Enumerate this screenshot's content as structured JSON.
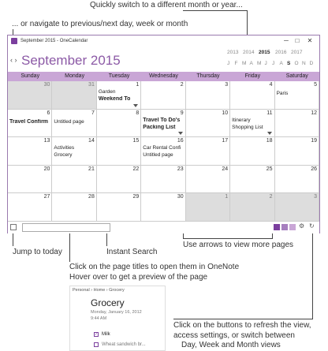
{
  "callouts": {
    "top": "Quickly switch to a different month or year...",
    "nav": "... or navigate to previous/next day, week or month",
    "today": "Jump to today",
    "search": "Instant Search",
    "arrows": "Use arrows to view more pages",
    "titles1": "Click on the page titles to open them in OneNote",
    "titles2": "Hover over to get a preview of the page",
    "buttons1": "Click on the buttons to refresh the view,",
    "buttons2": "access settings, or switch between",
    "buttons3": "Day, Week and Month views"
  },
  "window": {
    "title": "September 2015 - OneCalendar",
    "month_title": "September 2015",
    "minimize": "─",
    "maximize": "□",
    "close": "✕",
    "nav": "‹ ›"
  },
  "years": [
    "2013",
    "2014",
    "2015",
    "2016",
    "2017"
  ],
  "selected_year": "2015",
  "months": [
    "J",
    "F",
    "M",
    "A",
    "M",
    "J",
    "J",
    "A",
    "S",
    "O",
    "N",
    "D"
  ],
  "selected_month_index": 8,
  "day_headers": [
    "Sunday",
    "Monday",
    "Tuesday",
    "Wednesday",
    "Thursday",
    "Friday",
    "Saturday"
  ],
  "weeks": [
    [
      {
        "num": "30",
        "other": true,
        "pages": []
      },
      {
        "num": "31",
        "other": true,
        "pages": []
      },
      {
        "num": "1",
        "pages": [
          {
            "t": "Garden"
          },
          {
            "t": "Weekend To",
            "b": true
          }
        ],
        "more": true
      },
      {
        "num": "2",
        "pages": []
      },
      {
        "num": "3",
        "pages": []
      },
      {
        "num": "4",
        "pages": []
      },
      {
        "num": "5",
        "pages": [
          {
            "t": "Paris"
          }
        ]
      }
    ],
    [
      {
        "num": "6",
        "pages": [
          {
            "t": "Travel Confirm",
            "b": true
          }
        ]
      },
      {
        "num": "7",
        "pages": [
          {
            "t": "Untitled page"
          }
        ]
      },
      {
        "num": "8",
        "pages": []
      },
      {
        "num": "9",
        "pages": [
          {
            "t": "Travel To Do's",
            "b": true
          },
          {
            "t": "Packing List",
            "b": true
          }
        ],
        "more": true
      },
      {
        "num": "10",
        "pages": []
      },
      {
        "num": "11",
        "pages": [
          {
            "t": "Itinerary"
          },
          {
            "t": "Shopping List"
          }
        ],
        "more": true
      },
      {
        "num": "12",
        "pages": []
      }
    ],
    [
      {
        "num": "13",
        "pages": []
      },
      {
        "num": "14",
        "pages": [
          {
            "t": "Activities"
          },
          {
            "t": "Grocery"
          }
        ]
      },
      {
        "num": "15",
        "pages": []
      },
      {
        "num": "16",
        "pages": [
          {
            "t": "Car Rental Confi"
          },
          {
            "t": "Untitled page"
          }
        ]
      },
      {
        "num": "17",
        "pages": []
      },
      {
        "num": "18",
        "pages": []
      },
      {
        "num": "19",
        "pages": []
      }
    ],
    [
      {
        "num": "20",
        "pages": []
      },
      {
        "num": "21",
        "pages": []
      },
      {
        "num": "22",
        "pages": []
      },
      {
        "num": "23",
        "pages": []
      },
      {
        "num": "24",
        "pages": []
      },
      {
        "num": "25",
        "pages": []
      },
      {
        "num": "26",
        "pages": []
      }
    ],
    [
      {
        "num": "27",
        "pages": []
      },
      {
        "num": "28",
        "pages": []
      },
      {
        "num": "29",
        "pages": []
      },
      {
        "num": "30",
        "pages": []
      },
      {
        "num": "1",
        "other": true,
        "pages": []
      },
      {
        "num": "2",
        "other": true,
        "pages": []
      },
      {
        "num": "3",
        "other": true,
        "pages": []
      }
    ]
  ],
  "preview": {
    "breadcrumb": "Personal › Home › Grocery",
    "title": "Grocery",
    "date": "Monday, January 16, 2012",
    "time": "9:44 AM",
    "items": [
      "Milk",
      "Wheat sandwich br..."
    ]
  },
  "colors": {
    "accent": "#8c5aa6",
    "header": "#c9a6d6",
    "other_month": "#dddddd"
  }
}
